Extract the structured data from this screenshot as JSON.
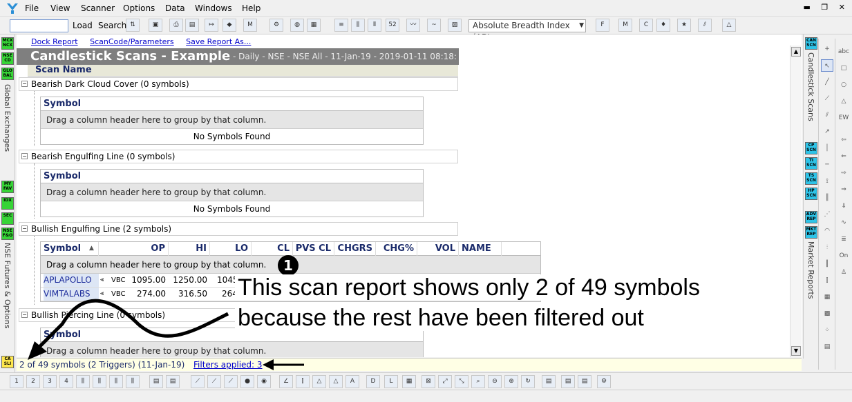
{
  "menu": {
    "items": [
      "File",
      "View",
      "Scanner",
      "Options",
      "Data",
      "Windows",
      "Help"
    ]
  },
  "toolbar": {
    "load_label": "Load",
    "search_label": "Search",
    "search_value": "",
    "indicator_select": "Absolute Breadth Index (ABI"
  },
  "left_strip": {
    "badges": [
      "MCX NCX",
      "NSE CD",
      "GLO BAL",
      "MY FAV",
      "IDX",
      "SEC",
      "NSE F&O",
      "CA SLI"
    ],
    "labels": [
      "Global Exchanges",
      "NSE Futures & Options"
    ]
  },
  "report": {
    "links": [
      "Dock Report",
      "ScanCode/Parameters",
      "Save Report As..."
    ],
    "title": "Candlestick Scans - Example",
    "subtitle": "- Daily - NSE - NSE All - 11-Jan-19 - 2019-01-11 08:18:",
    "scan_name_header": "Scan Name",
    "groups": [
      {
        "name": "Bearish Dark Cloud Cover (0 symbols)",
        "symbol_header": "Symbol",
        "drag_hint": "Drag a column header here to group by that column.",
        "empty_text": "No Symbols Found"
      },
      {
        "name": "Bearish Engulfing Line (0 symbols)",
        "symbol_header": "Symbol",
        "drag_hint": "Drag a column header here to group by that column.",
        "empty_text": "No Symbols Found"
      },
      {
        "name": "Bullish Engulfing Line (2 symbols)"
      },
      {
        "name": "Bullish Piercing Line (0 symbols)",
        "symbol_header": "Symbol",
        "drag_hint": "Drag a column header here to group by that column."
      }
    ],
    "bullish_grid": {
      "columns": [
        "Symbol",
        "OP",
        "HI",
        "LO",
        "CL",
        "PVS CL",
        "CHGRS",
        "CHG%",
        "VOL",
        "NAME"
      ],
      "drag_hint": "Drag a column header here to group by that column.",
      "rows": [
        {
          "symbol": "APLAPOLLO",
          "tag": "VBC",
          "op": "1095.00",
          "hi": "1250.00",
          "lo": "1045"
        },
        {
          "symbol": "VIMTALABS",
          "tag": "VBC",
          "op": "274.00",
          "hi": "316.50",
          "lo": "264"
        }
      ]
    }
  },
  "statusbar": {
    "count_text": "2 of 49 symbols (2 Triggers) (11-Jan-19)",
    "filters_text": "Filters applied: 3"
  },
  "right_strip": {
    "badges": [
      "CAN SCN",
      "CP SCN",
      "TI SCN",
      "TS SCN",
      "HP SCN",
      "ADV REP",
      "MKT REP"
    ],
    "labels": [
      "Candlestick Scans",
      "Market Reports"
    ]
  },
  "annotation": {
    "marker": "1",
    "line1": "This scan report shows only 2 of 49 symbols",
    "line2": "because the rest have been filtered out"
  }
}
